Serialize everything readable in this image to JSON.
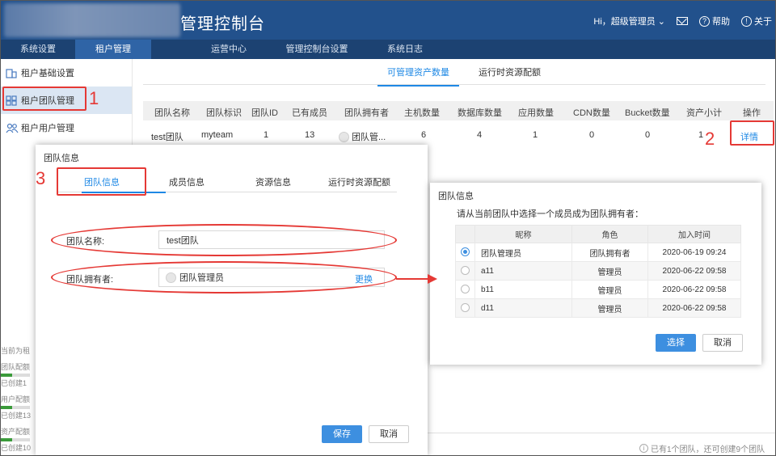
{
  "header": {
    "title": "管理控制台",
    "user": "Hi，超级管理员",
    "help": "帮助",
    "about": "关于"
  },
  "nav": [
    "系统设置",
    "租户管理",
    "运营中心",
    "管理控制台设置",
    "系统日志"
  ],
  "sidebar": {
    "items": [
      "租户基础设置",
      "租户团队管理",
      "租户用户管理"
    ],
    "bottom": {
      "l1": "当前为租",
      "l2": "团队配额",
      "l3": "已创建1",
      "l4": "用户配额",
      "l5": "已创建13",
      "l6": "资产配额",
      "l7": "已创建10"
    }
  },
  "main": {
    "tabs": [
      "可管理资产数量",
      "运行时资源配额"
    ],
    "columns": [
      "团队名称",
      "团队标识",
      "团队ID",
      "已有成员",
      "团队拥有者",
      "主机数量",
      "数据库数量",
      "应用数量",
      "CDN数量",
      "Bucket数量",
      "资产小计",
      "操作"
    ],
    "row": {
      "name": "test团队",
      "key": "myteam",
      "id": "1",
      "members": "13",
      "owner": "团队管...",
      "hosts": "6",
      "db": "4",
      "apps": "1",
      "cdn": "0",
      "bucket": "0",
      "subtotal": "1",
      "action": "详情"
    },
    "footer_note": "已有1个团队，还可创建9个团队"
  },
  "dialog1": {
    "title": "团队信息",
    "tabs": [
      "团队信息",
      "成员信息",
      "资源信息",
      "运行时资源配额"
    ],
    "name_label": "团队名称:",
    "name_value": "test团队",
    "owner_label": "团队拥有者:",
    "owner_value": "团队管理员",
    "change": "更换",
    "save": "保存",
    "cancel": "取消"
  },
  "dialog2": {
    "title": "团队信息",
    "prompt": "请从当前团队中选择一个成员成为团队拥有者：",
    "columns": [
      "昵称",
      "角色",
      "加入时间"
    ],
    "rows": [
      {
        "nick": "团队管理员",
        "role": "团队拥有者",
        "time": "2020-06-19 09:24",
        "selected": true
      },
      {
        "nick": "a11",
        "role": "管理员",
        "time": "2020-06-22 09:58",
        "selected": false
      },
      {
        "nick": "b11",
        "role": "管理员",
        "time": "2020-06-22 09:58",
        "selected": false
      },
      {
        "nick": "d11",
        "role": "管理员",
        "time": "2020-06-22 09:58",
        "selected": false
      }
    ],
    "select": "选择",
    "cancel": "取消"
  },
  "annotations": [
    "1",
    "2",
    "3"
  ],
  "colors": {
    "header": "#22518c",
    "nav": "#1c4272",
    "accent": "#1e88e5",
    "annotation": "#e53935"
  }
}
